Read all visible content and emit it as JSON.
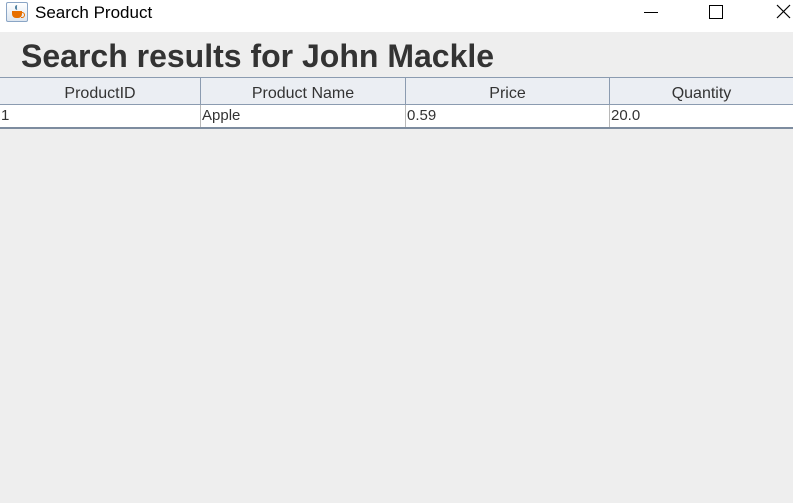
{
  "window": {
    "title": "Search Product",
    "icon": "java-cup-icon"
  },
  "heading": "Search results for John Mackle",
  "table": {
    "columns": [
      "ProductID",
      "Product Name",
      "Price",
      "Quantity"
    ],
    "rows": [
      [
        "1",
        "Apple",
        "0.59",
        "20.0"
      ]
    ]
  }
}
